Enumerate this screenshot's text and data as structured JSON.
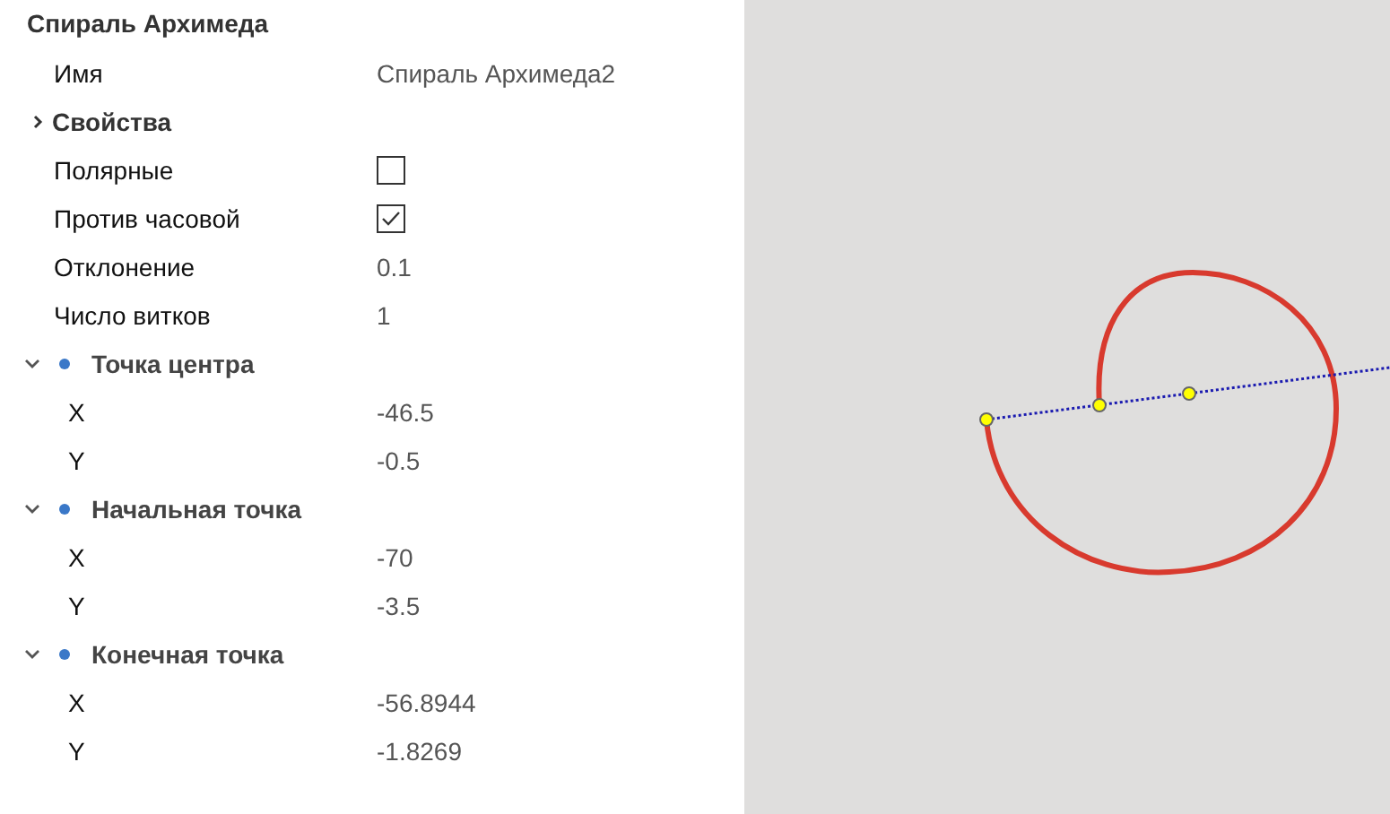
{
  "title": "Спираль Архимеда",
  "rows": [
    {
      "kind": "field",
      "label": "Имя",
      "value": "Спираль Архимеда2"
    },
    {
      "kind": "section",
      "label": "Свойства",
      "expanded": false
    },
    {
      "kind": "checkbox",
      "label": "Полярные",
      "checked": false
    },
    {
      "kind": "checkbox",
      "label": "Против часовой",
      "checked": true
    },
    {
      "kind": "field",
      "label": "Отклонение",
      "value": "0.1"
    },
    {
      "kind": "field",
      "label": "Число витков",
      "value": "1"
    },
    {
      "kind": "group",
      "label": "Точка центра",
      "expanded": true,
      "children": [
        {
          "label": "X",
          "value": "-46.5"
        },
        {
          "label": "Y",
          "value": "-0.5"
        }
      ]
    },
    {
      "kind": "group",
      "label": "Начальная точка",
      "expanded": true,
      "children": [
        {
          "label": "X",
          "value": "-70"
        },
        {
          "label": "Y",
          "value": "-3.5"
        }
      ]
    },
    {
      "kind": "group",
      "label": "Конечная точка",
      "expanded": true,
      "children": [
        {
          "label": "X",
          "value": "-56.8944"
        },
        {
          "label": "Y",
          "value": "-1.8269"
        }
      ]
    }
  ]
}
